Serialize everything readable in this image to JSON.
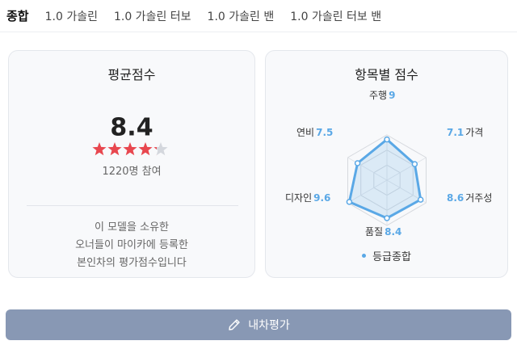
{
  "tabs": [
    {
      "label": "종합",
      "active": true
    },
    {
      "label": "1.0 가솔린",
      "active": false
    },
    {
      "label": "1.0 가솔린 터보",
      "active": false
    },
    {
      "label": "1.0 가솔린 밴",
      "active": false
    },
    {
      "label": "1.0 가솔린 터보 밴",
      "active": false
    }
  ],
  "average": {
    "title": "평균점수",
    "score": "8.4",
    "rating_out_of_5": 4.2,
    "participants": "1220명 참여",
    "description": [
      "이 모델을 소유한",
      "오너들이 마이카에 등록한",
      "본인차의 평가점수입니다"
    ]
  },
  "radar": {
    "title": "항목별 점수",
    "scale_max": 10,
    "items": [
      {
        "name": "주행",
        "value": "9"
      },
      {
        "name": "가격",
        "value": "7.1"
      },
      {
        "name": "거주성",
        "value": "8.6"
      },
      {
        "name": "품질",
        "value": "8.4"
      },
      {
        "name": "디자인",
        "value": "9.6"
      },
      {
        "name": "연비",
        "value": "7.5"
      }
    ],
    "legend": "등급종합"
  },
  "cta": {
    "label": "내차평가",
    "icon": "pencil-icon"
  },
  "colors": {
    "accent": "#5aa8e6",
    "star": "#e8474f",
    "button": "#8898b4"
  }
}
